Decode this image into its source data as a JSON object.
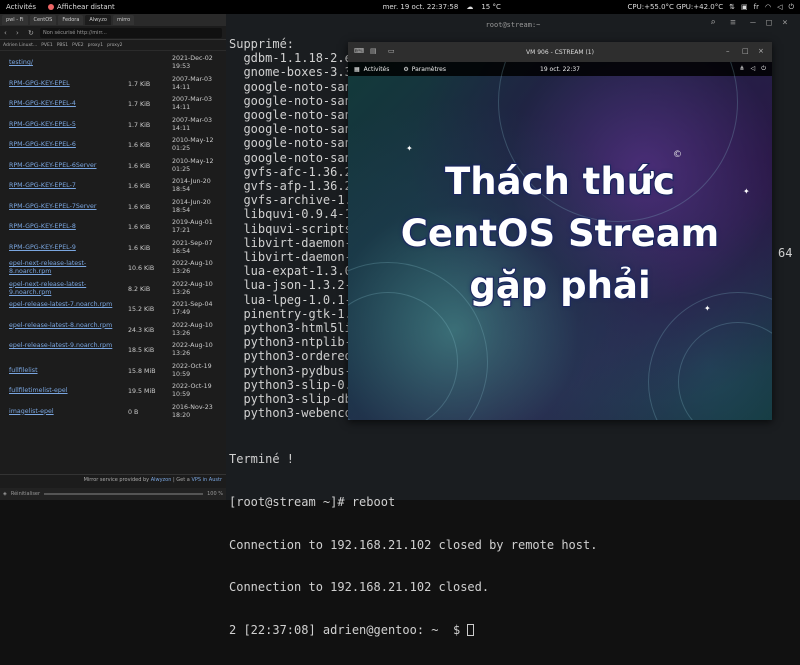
{
  "topbar": {
    "activities": "Activités",
    "app_name": "Affichear distant",
    "clock": "mer. 19 oct.  22:37:58",
    "weather": "15 °C",
    "cpu": "CPU:+55.0°C GPU:+42.0°C",
    "lang": "fr"
  },
  "browser": {
    "tabs": [
      "pwl - Fi",
      "CentOS",
      "Fedora",
      "Alwyzo",
      "mirro"
    ],
    "url": "Non sécurisé  http://mirr...",
    "bookmarks": [
      "Adrien Linuxt...",
      "PVE1",
      "PBS1",
      "PVE2",
      "proxy1",
      "proxy2"
    ],
    "files": [
      {
        "name": "testing/",
        "size": "",
        "date": "2021-Dec-02 19:53"
      },
      {
        "name": "RPM-GPG-KEY-EPEL",
        "size": "1.7 KiB",
        "date": "2007-Mar-03 14:11"
      },
      {
        "name": "RPM-GPG-KEY-EPEL-4",
        "size": "1.7 KiB",
        "date": "2007-Mar-03 14:11"
      },
      {
        "name": "RPM-GPG-KEY-EPEL-5",
        "size": "1.7 KiB",
        "date": "2007-Mar-03 14:11"
      },
      {
        "name": "RPM-GPG-KEY-EPEL-6",
        "size": "1.6 KiB",
        "date": "2010-May-12 01:25"
      },
      {
        "name": "RPM-GPG-KEY-EPEL-6Server",
        "size": "1.6 KiB",
        "date": "2010-May-12 01:25"
      },
      {
        "name": "RPM-GPG-KEY-EPEL-7",
        "size": "1.6 KiB",
        "date": "2014-Jun-20 18:54"
      },
      {
        "name": "RPM-GPG-KEY-EPEL-7Server",
        "size": "1.6 KiB",
        "date": "2014-Jun-20 18:54"
      },
      {
        "name": "RPM-GPG-KEY-EPEL-8",
        "size": "1.6 KiB",
        "date": "2019-Aug-01 17:21"
      },
      {
        "name": "RPM-GPG-KEY-EPEL-9",
        "size": "1.6 KiB",
        "date": "2021-Sep-07 16:54"
      },
      {
        "name": "epel-next-release-latest-8.noarch.rpm",
        "size": "10.6 KiB",
        "date": "2022-Aug-10 13:26"
      },
      {
        "name": "epel-next-release-latest-9.noarch.rpm",
        "size": "8.2 KiB",
        "date": "2022-Aug-10 13:26"
      },
      {
        "name": "epel-release-latest-7.noarch.rpm",
        "size": "15.2 KiB",
        "date": "2021-Sep-04 17:49"
      },
      {
        "name": "epel-release-latest-8.noarch.rpm",
        "size": "24.3 KiB",
        "date": "2022-Aug-10 13:26"
      },
      {
        "name": "epel-release-latest-9.noarch.rpm",
        "size": "18.5 KiB",
        "date": "2022-Aug-10 13:26"
      },
      {
        "name": "fullfilelist",
        "size": "15.8 MiB",
        "date": "2022-Oct-19 10:59"
      },
      {
        "name": "fullfiletimelist-epel",
        "size": "19.5 MiB",
        "date": "2022-Oct-19 10:59"
      },
      {
        "name": "imagelist-epel",
        "size": "0 B",
        "date": "2016-Nov-23 18:20"
      }
    ],
    "footer_text": "Mirror service provided by",
    "footer_link1": "Alwyzon",
    "footer_sep": "| Get a",
    "footer_link2": "VPS in Austr",
    "status_label": "Réinitialiser",
    "zoom": "100 %"
  },
  "terminal": {
    "title": "root@stream:~",
    "lines": [
      "Supprimé:",
      "  gdbm-1.1.18-2.el8",
      "  gnome-boxes-3.36.",
      "  google-noto-sans-",
      "  google-noto-sans-",
      "  google-noto-sans-",
      "  google-noto-sans-",
      "  google-noto-sans-",
      "  google-noto-sans-",
      "  gvfs-afc-1.36.2-1",
      "  gvfs-afp-1.36.2-1",
      "  gvfs-archive-1.36",
      "  libquvi-0.9.4-12.",
      "  libquvi-scripts-0",
      "  libvirt-daemon-dr",
      "  libvirt-daemon-dr",
      "  lua-expat-1.3.0-1",
      "  lua-json-1.3.2-9.",
      "  lua-lpeg-1.0.1-6.",
      "  pinentry-gtk-1.1.",
      "  python3-html5lib-",
      "  python3-ntplib-0.",
      "  python3-ordered-s",
      "  python3-pydbus-0.",
      "  python3-slip-0.6.",
      "  python3-slip-dbus",
      "  python3-webencodi"
    ],
    "side_fragment": "64",
    "done": "Terminé !",
    "cmd": "[root@stream ~]# reboot",
    "conn1": "Connection to 192.168.21.102 closed by remote host.",
    "conn2": "Connection to 192.168.21.102 closed.",
    "prompt": "2 [22:37:08] adrien@gentoo: ~  $ "
  },
  "vm": {
    "title": "VM 906 - CSTREAM (1)",
    "activities": "Activités",
    "settings": "Paramètres",
    "clock": "19 oct.  22:37",
    "headline": [
      "Thách thức",
      "CentOS Stream",
      "gặp phải"
    ]
  }
}
